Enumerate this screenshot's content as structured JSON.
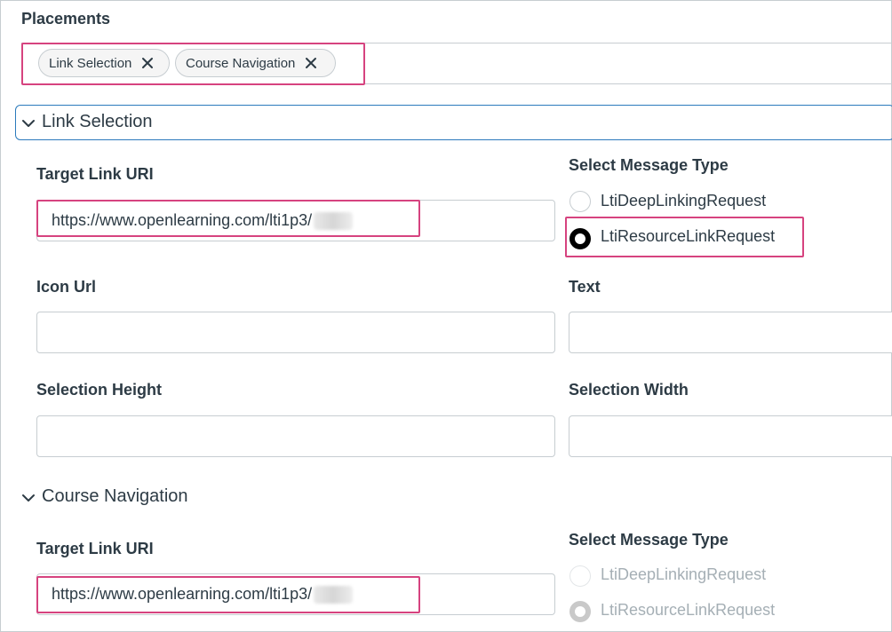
{
  "placements": {
    "title": "Placements",
    "chips": [
      {
        "label": "Link Selection"
      },
      {
        "label": "Course Navigation"
      }
    ]
  },
  "link_selection": {
    "toggle_label": "Link Selection",
    "target_link_uri_label": "Target Link URI",
    "target_link_uri_value": "https://www.openlearning.com/lti1p3/",
    "select_message_type_label": "Select Message Type",
    "message_types": [
      {
        "label": "LtiDeepLinkingRequest",
        "selected": false
      },
      {
        "label": "LtiResourceLinkRequest",
        "selected": true
      }
    ],
    "icon_url_label": "Icon Url",
    "icon_url_value": "",
    "text_label": "Text",
    "text_value": "",
    "selection_height_label": "Selection Height",
    "selection_height_value": "",
    "selection_width_label": "Selection Width",
    "selection_width_value": ""
  },
  "course_navigation": {
    "toggle_label": "Course Navigation",
    "target_link_uri_label": "Target Link URI",
    "target_link_uri_value": "https://www.openlearning.com/lti1p3/",
    "select_message_type_label": "Select Message Type",
    "message_types": [
      {
        "label": "LtiDeepLinkingRequest",
        "selected": false,
        "disabled": true
      },
      {
        "label": "LtiResourceLinkRequest",
        "selected": true,
        "disabled": true
      }
    ]
  },
  "colors": {
    "highlight": "#d6437f",
    "focus_border": "#2b7abc",
    "text": "#2d3b45"
  }
}
